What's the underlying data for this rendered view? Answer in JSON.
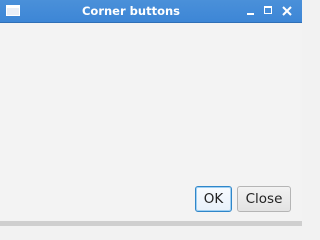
{
  "window": {
    "title": "Corner buttons",
    "controls": {
      "minimize_icon": "minimize-icon",
      "maximize_icon": "maximize-icon",
      "close_icon": "close-icon"
    }
  },
  "buttons": {
    "ok_label": "OK",
    "close_label": "Close"
  },
  "colors": {
    "titlebar": "#4a90d9",
    "background": "#f3f3f3",
    "focus_border": "#2f86c9"
  }
}
